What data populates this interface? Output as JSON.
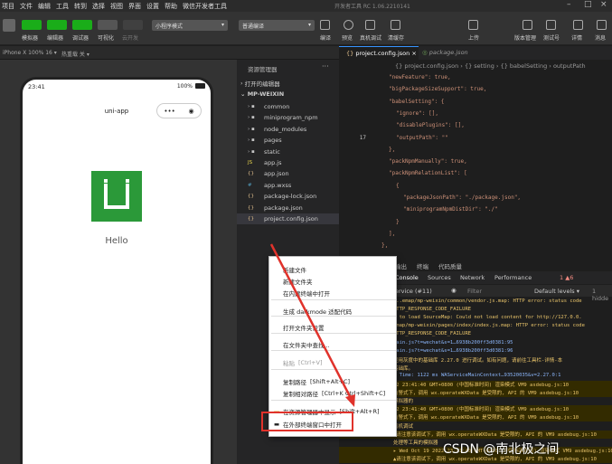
{
  "menubar": {
    "items": [
      "项目",
      "文件",
      "编辑",
      "工具",
      "转到",
      "选择",
      "视图",
      "界面",
      "设置",
      "帮助",
      "微信开发者工具"
    ],
    "title": "开发者工具 RC 1.06.2210141"
  },
  "toolbar": {
    "left_labels": [
      "模拟器",
      "编辑器",
      "调试器",
      "可视化",
      "云开发"
    ],
    "mode_select": "小程序模式",
    "compile_select": "普通编译",
    "mid_labels": [
      "编译",
      "预览",
      "真机调试",
      "清缓存"
    ],
    "right_labels": [
      "上传",
      "版本管理",
      "测试号",
      "详情",
      "消息"
    ]
  },
  "subbar": {
    "device": "iPhone X 100% 16 ▾",
    "hotreload": "热重载 关 ▾"
  },
  "phone": {
    "time": "23:41",
    "battery": "100%",
    "nav_title": "uni-app",
    "logo_color": "#2b9939",
    "hello": "Hello"
  },
  "explorer": {
    "title": "资源管理器",
    "sections": [
      "打开的编辑器",
      "MP-WEIXIN"
    ],
    "items": [
      {
        "name": "common",
        "kind": "folder"
      },
      {
        "name": "miniprogram_npm",
        "kind": "folder"
      },
      {
        "name": "node_modules",
        "kind": "folder"
      },
      {
        "name": "pages",
        "kind": "folder"
      },
      {
        "name": "static",
        "kind": "folder"
      },
      {
        "name": "app.js",
        "kind": "js"
      },
      {
        "name": "app.json",
        "kind": "json"
      },
      {
        "name": "app.wxss",
        "kind": "wxss"
      },
      {
        "name": "package-lock.json",
        "kind": "json"
      },
      {
        "name": "package.json",
        "kind": "json"
      },
      {
        "name": "project.config.json",
        "kind": "json"
      }
    ]
  },
  "editor": {
    "tabs": [
      "project.config.json",
      "package.json"
    ],
    "breadcrumb": [
      "{} project.config.json",
      "{} setting",
      "{} babelSetting",
      "outputPath"
    ],
    "lines": [
      {
        "n": "",
        "text": "\"newFeature\": true,"
      },
      {
        "n": "",
        "text": "\"bigPackageSizeSupport\": true,"
      },
      {
        "n": "",
        "text": "\"babelSetting\": {"
      },
      {
        "n": "",
        "text": "\"ignore\": [],"
      },
      {
        "n": "",
        "text": "\"disablePlugins\": [],"
      },
      {
        "n": "17",
        "text": "\"outputPath\": \"\""
      },
      {
        "n": "",
        "text": "},"
      },
      {
        "n": "",
        "text": "\"packNpmManually\": true,"
      },
      {
        "n": "",
        "text": "\"packNpmRelationList\": ["
      },
      {
        "n": "",
        "text": "{"
      },
      {
        "n": "",
        "text": "\"packageJsonPath\": \"./package.json\","
      },
      {
        "n": "",
        "text": "\"miniprogramNpmDistDir\": \"./\""
      },
      {
        "n": "",
        "text": "}"
      },
      {
        "n": "",
        "text": "],"
      },
      {
        "n": "",
        "text": "},"
      }
    ]
  },
  "console": {
    "tabs": [
      "输出",
      "终端",
      "代码质量"
    ],
    "devtabs": [
      "Console",
      "Sources",
      "Network",
      "Performance"
    ],
    "status": "1 ▲6",
    "context": "ervice (#11)",
    "filter": "Filter",
    "levels": "Default levels ▾",
    "hidden": "1 hidde",
    "logs": [
      "...emap/mp-weixin/common/vendor.js.map: HTTP error: status code",
      "HTTP_RESPONSE_CODE_FAILURE",
      "d to load SourceMap: Could not load content for http://127.0.0.",
      "emap/mp-weixin/pages/index/index.js.map: HTTP error: status code",
      "HTTP_RESPONSE_CODE_FAILURE",
      "                         main.js?t=wechat&s=1…6938b200ff3d0381:95",
      "                         main.js?t=wechat&s=1…6938b200ff3d0381:96",
      "使用灰度中的基础库 2.27.0 进行调试。如有问题，请前往工具栏-详情-本",
      "基础库。",
      "h Time: 1122 ms          WAServiceMainContext…93520035&v=2.27.0:1",
      "22 23:41:40 GMT+0800 (中国标准时间) 渲染模式   VM9 asdebug.js:10",
      "告警式下，调用 wx.operateWXData 是受限的, API 的 VM9 asdebug.js:10",
      "模拟器的",
      "22 23:41:40 GMT+0800 (中国标准时间) 渲染模式   VM9 asdebug.js:10",
      "告警式下，调用 wx.operateWXData 是受限的, API 的 VM9 asdebug.js:10",
      "真机调试",
      "▲请注意该调试下，调用 wx.operateWXData 是受限的, API 的 VM9 asdebug.js:10",
      " 处理等工具的模拟器",
      "▸ Wed Oct 19 2022 23:41:40 GMT+0800 (中国标准时间) 渲染模式  VM9 asdebug.js:10",
      "▲请注意该调试下，调用 wx.operateWXData 是受限的, API 的 VM9 asdebug.js:10"
    ]
  },
  "context_menu": {
    "items": [
      {
        "label": "新建文件",
        "shortcut": ""
      },
      {
        "label": "新建文件夹",
        "shortcut": ""
      },
      {
        "label": "在内建终端中打开",
        "shortcut": ""
      },
      {
        "label": "生成 darkmode 适配代码",
        "shortcut": ""
      },
      {
        "label": "打开文件夹设置",
        "shortcut": ""
      },
      {
        "label": "在文件夹中查找...",
        "shortcut": ""
      },
      {
        "label": "粘贴",
        "shortcut": "[Ctrl+V]",
        "disabled": true
      },
      {
        "label": "复制路径",
        "shortcut": "[Shift+Alt+C]"
      },
      {
        "label": "复制相对路径",
        "shortcut": "[Ctrl+K Ctrl+Shift+C]"
      },
      {
        "label": "在资源管理器中显示",
        "shortcut": "[Shift+Alt+R]"
      },
      {
        "label": "在外部终端窗口中打开",
        "shortcut": ""
      }
    ],
    "highlight_color": "#e0322b"
  },
  "watermark": "CSDN @南北极之间"
}
